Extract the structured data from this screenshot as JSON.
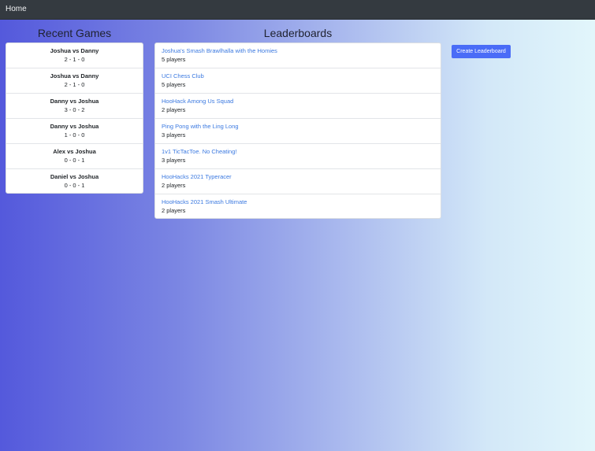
{
  "navbar": {
    "home_label": "Home"
  },
  "recent_games": {
    "title": "Recent Games",
    "items": [
      {
        "title": "Joshua vs Danny",
        "score": "2 - 1 - 0"
      },
      {
        "title": "Joshua vs Danny",
        "score": "2 - 1 - 0"
      },
      {
        "title": "Danny vs Joshua",
        "score": "3 - 0 - 2"
      },
      {
        "title": "Danny vs Joshua",
        "score": "1 - 0 - 0"
      },
      {
        "title": "Alex vs Joshua",
        "score": "0 - 0 - 1"
      },
      {
        "title": "Daniel vs Joshua",
        "score": "0 - 0 - 1"
      }
    ]
  },
  "leaderboards": {
    "title": "Leaderboards",
    "items": [
      {
        "name": "Joshua's Smash Brawlhalla with the Homies",
        "players": "5 players"
      },
      {
        "name": "UCI Chess Club",
        "players": "5 players"
      },
      {
        "name": "HooHack Among Us Squad",
        "players": "2 players"
      },
      {
        "name": "Ping Pong with the Ling Long",
        "players": "3 players"
      },
      {
        "name": "1v1 TicTacToe. No Cheating!",
        "players": "3 players"
      },
      {
        "name": "HooHacks 2021 Typeracer",
        "players": "2 players"
      },
      {
        "name": "HooHacks 2021 Smash Ultimate",
        "players": "2 players"
      }
    ]
  },
  "actions": {
    "create_label": "Create Leaderboard"
  },
  "colors": {
    "navbar": "#343a40",
    "link": "#3b79e0",
    "button": "#4a6cf7"
  }
}
